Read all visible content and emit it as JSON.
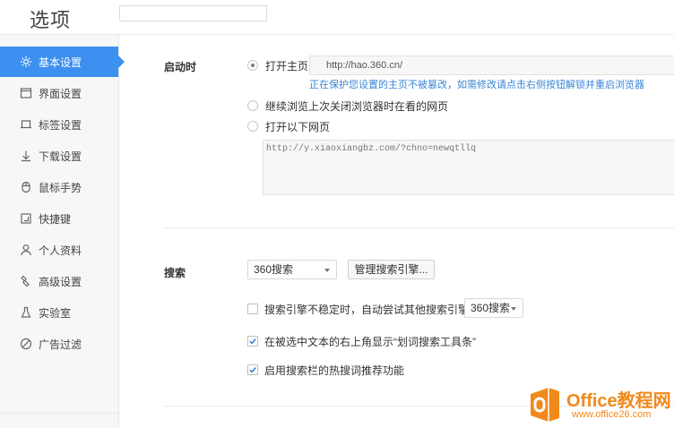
{
  "header": {
    "title": "选项",
    "search_placeholder": ""
  },
  "sidebar": {
    "items": [
      {
        "label": "基本设置",
        "icon": "gear-icon",
        "active": true
      },
      {
        "label": "界面设置",
        "icon": "window-icon"
      },
      {
        "label": "标签设置",
        "icon": "tab-icon"
      },
      {
        "label": "下载设置",
        "icon": "download-icon"
      },
      {
        "label": "鼠标手势",
        "icon": "mouse-icon"
      },
      {
        "label": "快捷键",
        "icon": "shortcut-icon"
      },
      {
        "label": "个人资料",
        "icon": "user-icon"
      },
      {
        "label": "高级设置",
        "icon": "wrench-icon"
      },
      {
        "label": "实验室",
        "icon": "flask-icon"
      },
      {
        "label": "广告过滤",
        "icon": "block-icon"
      }
    ],
    "bottom_item": "",
    "accent_color": "#3d8ff0"
  },
  "startup": {
    "label": "启动时",
    "option_home": "打开主页",
    "home_url": "http://hao.360.cn/",
    "protect_hint": "正在保护您设置的主页不被篡改，如需修改请点击右侧按钮解锁并重启浏览器",
    "option_continue": "继续浏览上次关闭浏览器时在看的网页",
    "option_pages": "打开以下网页",
    "pages_text": "http://y.xiaoxiangbz.com/?chno=newqtllq"
  },
  "search": {
    "label": "搜索",
    "engine_selected": "360搜索",
    "manage_button": "管理搜索引擎...",
    "fallback_label": "搜索引擎不稳定时，自动尝试其他搜索引擎：",
    "fallback_selected": "360搜索",
    "show_toolbar_label": "在被选中文本的右上角显示“划词搜索工具条”",
    "hot_words_label": "启用搜索栏的热搜词推荐功能"
  },
  "watermark": {
    "title": "Office教程网",
    "url": "www.office26.com",
    "color": "#f08a1c"
  }
}
